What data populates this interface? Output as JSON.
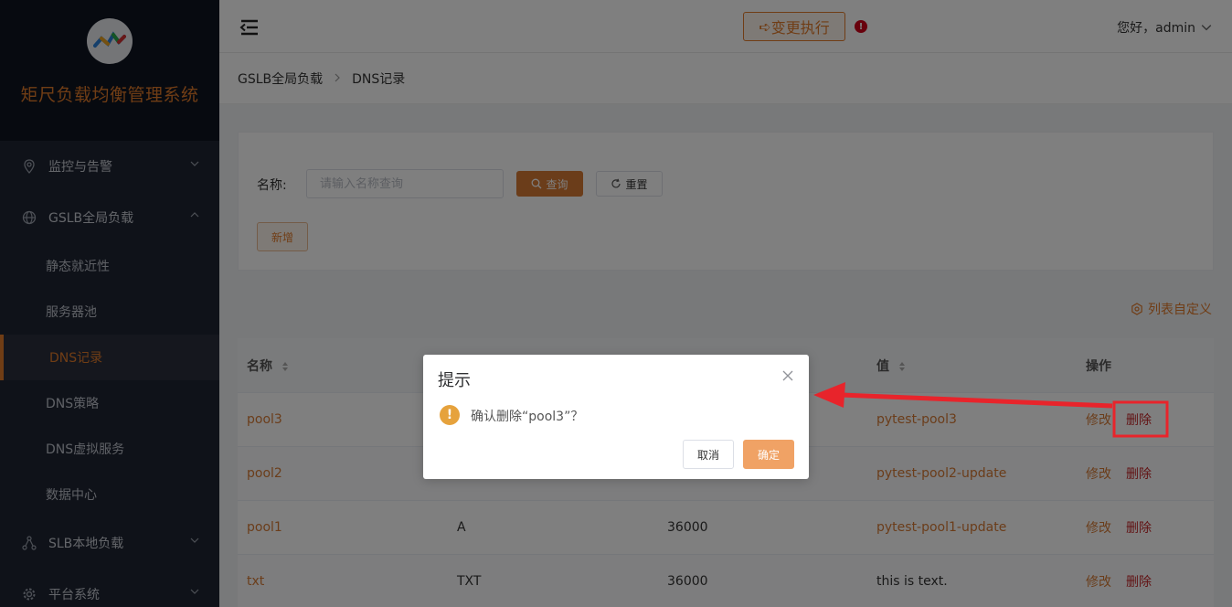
{
  "sidebar": {
    "brand_title": "矩尺负载均衡管理系统",
    "groups": [
      {
        "label": "监控与告警",
        "icon": "location-pin-icon"
      },
      {
        "label": "GSLB全局负载",
        "icon": "globe-icon"
      },
      {
        "label": "SLB本地负载",
        "icon": "network-nodes-icon"
      },
      {
        "label": "平台系统",
        "icon": "gear-icon"
      }
    ],
    "gslb_items": [
      {
        "label": "静态就近性"
      },
      {
        "label": "服务器池"
      },
      {
        "label": "DNS记录"
      },
      {
        "label": "DNS策略"
      },
      {
        "label": "DNS虚拟服务"
      },
      {
        "label": "数据中心"
      }
    ]
  },
  "header": {
    "change_btn": "变更执行",
    "alert_mark": "!",
    "greeting": "您好，admin"
  },
  "breadcrumb": {
    "parent": "GSLB全局负载",
    "current": "DNS记录"
  },
  "search": {
    "label": "名称:",
    "placeholder": "请输入名称查询",
    "query_btn": "查询",
    "reset_btn": "重置",
    "add_btn": "新增"
  },
  "column_custom": "列表自定义",
  "table": {
    "headers": {
      "name": "名称",
      "value": "值",
      "ops": "操作"
    },
    "rows": [
      {
        "name": "pool3",
        "type": "",
        "ttl": "",
        "value": "pytest-pool3"
      },
      {
        "name": "pool2",
        "type": "",
        "ttl": "",
        "value": "pytest-pool2-update"
      },
      {
        "name": "pool1",
        "type": "A",
        "ttl": "36000",
        "value": "pytest-pool1-update"
      },
      {
        "name": "txt",
        "type": "TXT",
        "ttl": "36000",
        "value": "this is text."
      }
    ],
    "edit_label": "修改",
    "delete_label": "删除"
  },
  "dialog": {
    "title": "提示",
    "message": "确认删除“pool3”？",
    "cancel": "取消",
    "ok": "确定"
  },
  "colors": {
    "accent": "#e07a2b",
    "danger": "#c5282b",
    "sidebar_bg": "#1f2533",
    "annotation": "#e8242b"
  }
}
